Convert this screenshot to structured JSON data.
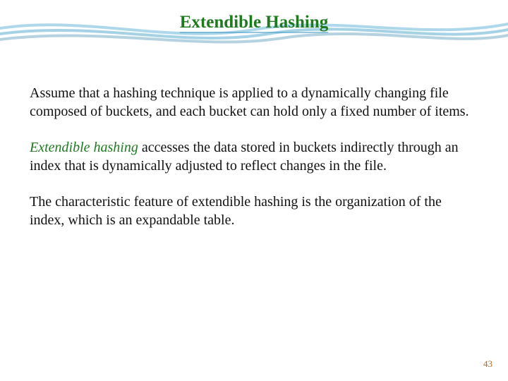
{
  "title": "Extendible Hashing",
  "paragraphs": {
    "p1": "Assume that a hashing technique is applied to a dynamically changing file composed of buckets, and each bucket can hold only a fixed number of items.",
    "p2_term": "Extendible hashing",
    "p2_rest": " accesses the data stored in buckets indirectly through an index that is dynamically adjusted to reflect changes in the file.",
    "p3": "The characteristic feature of extendible hashing is the organization of the index, which is an expandable table."
  },
  "page_number": "43"
}
